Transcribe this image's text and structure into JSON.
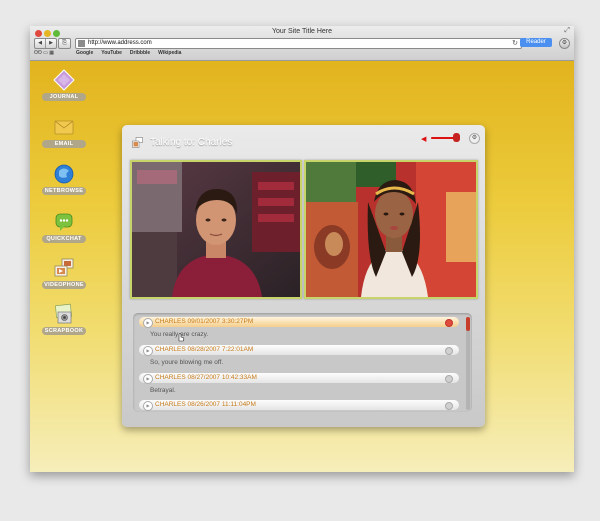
{
  "window": {
    "title": "Your Site Title Here",
    "url": "http://www.address.com",
    "reader_label": "Reader",
    "bookmarks": [
      "Google",
      "YouTube",
      "Dribbble",
      "Wikipedia"
    ]
  },
  "sidebar": {
    "items": [
      {
        "label": "JOURNAL",
        "icon": "journal-icon"
      },
      {
        "label": "EMAIL",
        "icon": "email-icon"
      },
      {
        "label": "NETBROWSE",
        "icon": "netbrowse-icon"
      },
      {
        "label": "QUICKCHAT",
        "icon": "quickchat-icon"
      },
      {
        "label": "VIDEOPHONE",
        "icon": "videophone-icon"
      },
      {
        "label": "SCRAPBOOK",
        "icon": "scrapbook-icon"
      }
    ]
  },
  "videophone": {
    "title": "Talking to: Charles",
    "volume_level": 0.85,
    "messages": [
      {
        "header": "CHARLES 09/01/2007 3:30:27PM",
        "text": "You really are crazy.",
        "active": true
      },
      {
        "header": "CHARLES 08/28/2007 7:22:01AM",
        "text": "So, youre blowing me off.",
        "active": false
      },
      {
        "header": "CHARLES 08/27/2007 10:42:33AM",
        "text": "Betrayal.",
        "active": false
      },
      {
        "header": "CHARLES 08/26/2007 11:11:04PM",
        "text": "",
        "active": false
      }
    ]
  },
  "colors": {
    "accent": "#e14b3a",
    "message_name": "#c77b17",
    "video_border": "#c6d46a",
    "sidebar_label_bg": "#b0a689"
  }
}
